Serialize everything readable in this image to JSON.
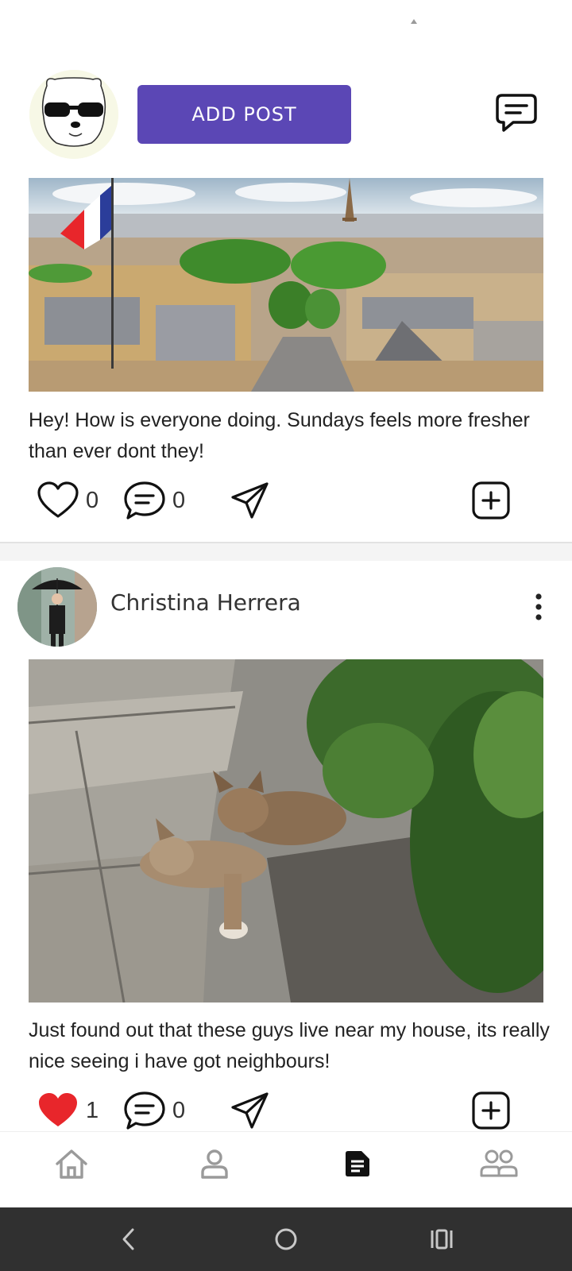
{
  "header": {
    "add_post_label": "ADD POST",
    "avatar_icon": "bear-sunglasses-avatar",
    "chat_icon": "chat-bubble-icon"
  },
  "posts": [
    {
      "image": "paris-eiffel-tower-flag-photo",
      "text": "Hey! How is everyone doing. Sundays feels more fresher than ever dont they!",
      "likes": "0",
      "comments": "0",
      "liked": false
    },
    {
      "author": "Christina Herrera",
      "image": "two-kittens-sunbathing-photo",
      "text": "Just found out that these guys live near my house, its really nice seeing i have got neighbours!",
      "likes": "1",
      "comments": "0",
      "liked": true
    }
  ],
  "bottom_nav": [
    "home-icon",
    "profile-icon",
    "posts-icon",
    "friends-icon"
  ],
  "system_nav": [
    "back-icon",
    "home-circle-icon",
    "recents-icon"
  ],
  "colors": {
    "accent": "#5b47b5",
    "like_active": "#e8262b",
    "system_bar": "#303030"
  }
}
